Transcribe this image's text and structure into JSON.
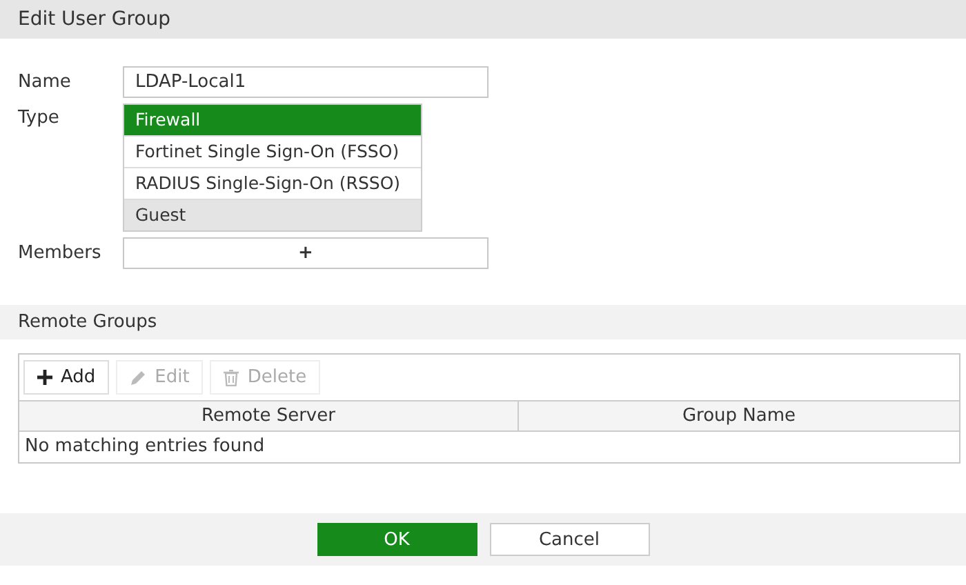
{
  "window": {
    "title": "Edit User Group"
  },
  "form": {
    "name": {
      "label": "Name",
      "value": "LDAP-Local1"
    },
    "type": {
      "label": "Type",
      "options": [
        {
          "label": "Firewall",
          "selected": true,
          "hovered": false
        },
        {
          "label": "Fortinet Single Sign-On (FSSO)",
          "selected": false,
          "hovered": false
        },
        {
          "label": "RADIUS Single-Sign-On (RSSO)",
          "selected": false,
          "hovered": false
        },
        {
          "label": "Guest",
          "selected": false,
          "hovered": true
        }
      ]
    },
    "members": {
      "label": "Members",
      "add_symbol": "+"
    }
  },
  "remote_groups": {
    "title": "Remote Groups",
    "toolbar": [
      {
        "kind": "add",
        "label": "Add",
        "disabled": false
      },
      {
        "kind": "edit",
        "label": "Edit",
        "disabled": true
      },
      {
        "kind": "delete",
        "label": "Delete",
        "disabled": true
      }
    ],
    "table": {
      "columns": [
        "Remote Server",
        "Group Name"
      ],
      "empty_message": "No matching entries found"
    }
  },
  "buttons": [
    {
      "kind": "primary",
      "label": "OK"
    },
    {
      "kind": "secondary",
      "label": "Cancel"
    }
  ]
}
